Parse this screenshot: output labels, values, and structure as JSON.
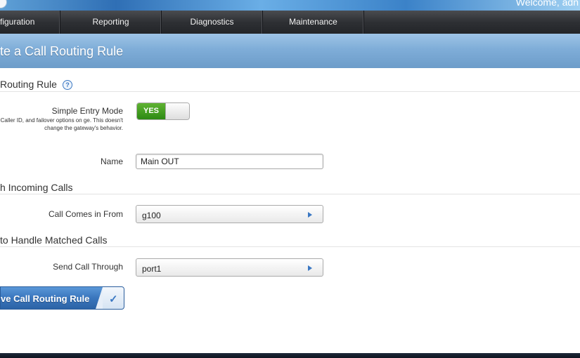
{
  "header": {
    "welcome": "Welcome, adn"
  },
  "nav": {
    "items": [
      {
        "label": "figuration"
      },
      {
        "label": "Reporting"
      },
      {
        "label": "Diagnostics"
      },
      {
        "label": "Maintenance"
      }
    ]
  },
  "page": {
    "title": "te a Call Routing Rule"
  },
  "sections": {
    "routing": {
      "title": "Routing Rule",
      "help": "?"
    },
    "incoming": {
      "title": "h Incoming Calls"
    },
    "handle": {
      "title": "to Handle Matched Calls"
    }
  },
  "form": {
    "simple_entry": {
      "label": "Simple Entry Mode",
      "description": "e DID, Caller ID, and failover options on ge. This doesn't change the gateway's behavior.",
      "toggle_on": "YES"
    },
    "name": {
      "label": "Name",
      "value": "Main OUT"
    },
    "call_from": {
      "label": "Call Comes in From",
      "value": "g100"
    },
    "send_through": {
      "label": "Send Call Through",
      "value": "port1"
    }
  },
  "actions": {
    "save_label": "ve Call Routing Rule",
    "save_icon": "checkmark-icon"
  },
  "colors": {
    "accent": "#3b78c3",
    "toggle_on": "#3d9a1f",
    "title_band": "#7fadd8"
  }
}
